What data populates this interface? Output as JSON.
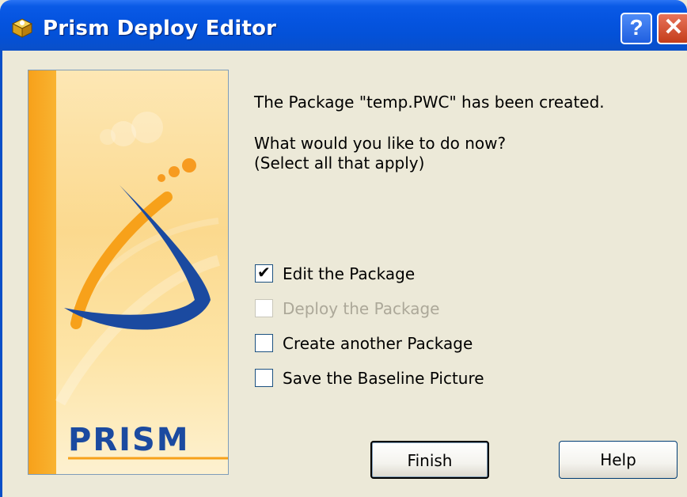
{
  "window": {
    "title": "Prism Deploy Editor",
    "help_button": "?",
    "close_button": "✕"
  },
  "sidebar": {
    "logo_text": "PRISM"
  },
  "message": {
    "line1": "The Package \"temp.PWC\" has been created.",
    "line2": "What would you like to do now?",
    "line3": "(Select all that apply)"
  },
  "options": [
    {
      "label": "Edit the Package",
      "checked": true,
      "enabled": true
    },
    {
      "label": "Deploy the Package",
      "checked": false,
      "enabled": false
    },
    {
      "label": "Create another Package",
      "checked": false,
      "enabled": true
    },
    {
      "label": "Save the Baseline Picture",
      "checked": false,
      "enabled": true
    }
  ],
  "buttons": {
    "finish": "Finish",
    "help": "Help"
  },
  "colors": {
    "titlebar": "#0554e0",
    "dialog_bg": "#ece9d8",
    "logo_blue": "#1b4aa0",
    "logo_orange": "#f7a11a"
  }
}
